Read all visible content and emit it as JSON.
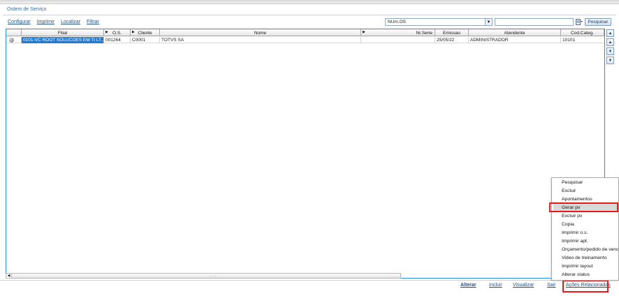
{
  "window": {
    "title": "Ordem de Serviço"
  },
  "toolbar": {
    "configurar": "Configurar",
    "imprimir": "Imprimir",
    "localizar": "Localizar",
    "filtrar": "Filtrar"
  },
  "search": {
    "field": "NUm.OS",
    "value": "",
    "button": "Pesquisar"
  },
  "grid": {
    "columns": [
      "Filial",
      "O.S.",
      "Cliente",
      "Nome",
      "Nr.Serie",
      "Emissao",
      "Atendente",
      "Cod.Categ."
    ],
    "rows": [
      {
        "filial": "0101-VC ROOT SOLUCOES EM TI LT...",
        "os": "001264",
        "cliente": "C0001",
        "nome": "TOTVS SA",
        "nr_serie": "",
        "emissao": "25/05/22",
        "atendente": "ADMINISTRADOR",
        "cod_categ": "10101"
      }
    ]
  },
  "side_nav": {
    "top": "▲",
    "up": "▲",
    "down": "▼",
    "bottom": "▼"
  },
  "bottom_actions": {
    "alterar": "Alterar",
    "incluir": "Incluir",
    "visualizar": "Visualizar",
    "sair": "Sair",
    "acoes": "Ações Relacionadas"
  },
  "menu": {
    "items": [
      "Pesquisar",
      "Excluir",
      "Apontamentos",
      "Gerar pv",
      "Excluir pv",
      "Copia",
      "Imprimir o.s.",
      "Imprimir apt.",
      "Orçamento/pedido de venda",
      "Video de treinamento",
      "Imprimir layout",
      "Alterar status"
    ],
    "active_index": 3
  },
  "colors": {
    "selection": "#1e7ad6",
    "highlight": "#e31b1b",
    "link": "#1f4f86",
    "border": "#2a8ad4"
  }
}
